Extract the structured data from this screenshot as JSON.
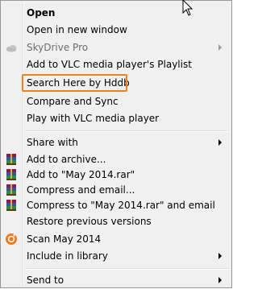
{
  "menu": {
    "items": [
      {
        "label": "Open",
        "icon": "",
        "bold": true,
        "disabled": false,
        "submenu": false
      },
      {
        "label": "Open in new window",
        "icon": "",
        "bold": false,
        "disabled": false,
        "submenu": false
      },
      {
        "label": "SkyDrive Pro",
        "icon": "skydrive-icon",
        "bold": false,
        "disabled": true,
        "submenu": true
      },
      {
        "label": "Add to VLC media player's Playlist",
        "icon": "",
        "bold": false,
        "disabled": false,
        "submenu": false
      },
      {
        "label": "Search Here by Hddb",
        "icon": "",
        "bold": false,
        "disabled": false,
        "submenu": false
      },
      {
        "label": "Compare and Sync",
        "icon": "",
        "bold": false,
        "disabled": false,
        "submenu": false
      },
      {
        "label": "Play with VLC media player",
        "icon": "",
        "bold": false,
        "disabled": false,
        "submenu": false
      },
      {
        "label": "Share with",
        "icon": "",
        "bold": false,
        "disabled": false,
        "submenu": true
      },
      {
        "label": "Add to archive...",
        "icon": "winrar-icon",
        "bold": false,
        "disabled": false,
        "submenu": false
      },
      {
        "label": "Add to \"May 2014.rar\"",
        "icon": "winrar-icon",
        "bold": false,
        "disabled": false,
        "submenu": false
      },
      {
        "label": "Compress and email...",
        "icon": "winrar-icon",
        "bold": false,
        "disabled": false,
        "submenu": false
      },
      {
        "label": "Compress to \"May 2014.rar\" and email",
        "icon": "winrar-icon",
        "bold": false,
        "disabled": false,
        "submenu": false
      },
      {
        "label": "Restore previous versions",
        "icon": "",
        "bold": false,
        "disabled": false,
        "submenu": false
      },
      {
        "label": "Scan May 2014",
        "icon": "avast-icon",
        "bold": false,
        "disabled": false,
        "submenu": false
      },
      {
        "label": "Include in library",
        "icon": "",
        "bold": false,
        "disabled": false,
        "submenu": true
      },
      {
        "label": "Send to",
        "icon": "",
        "bold": false,
        "disabled": false,
        "submenu": true
      }
    ],
    "highlighted_item": "Search Here by Hddb",
    "highlight_color": "#f0821e"
  }
}
